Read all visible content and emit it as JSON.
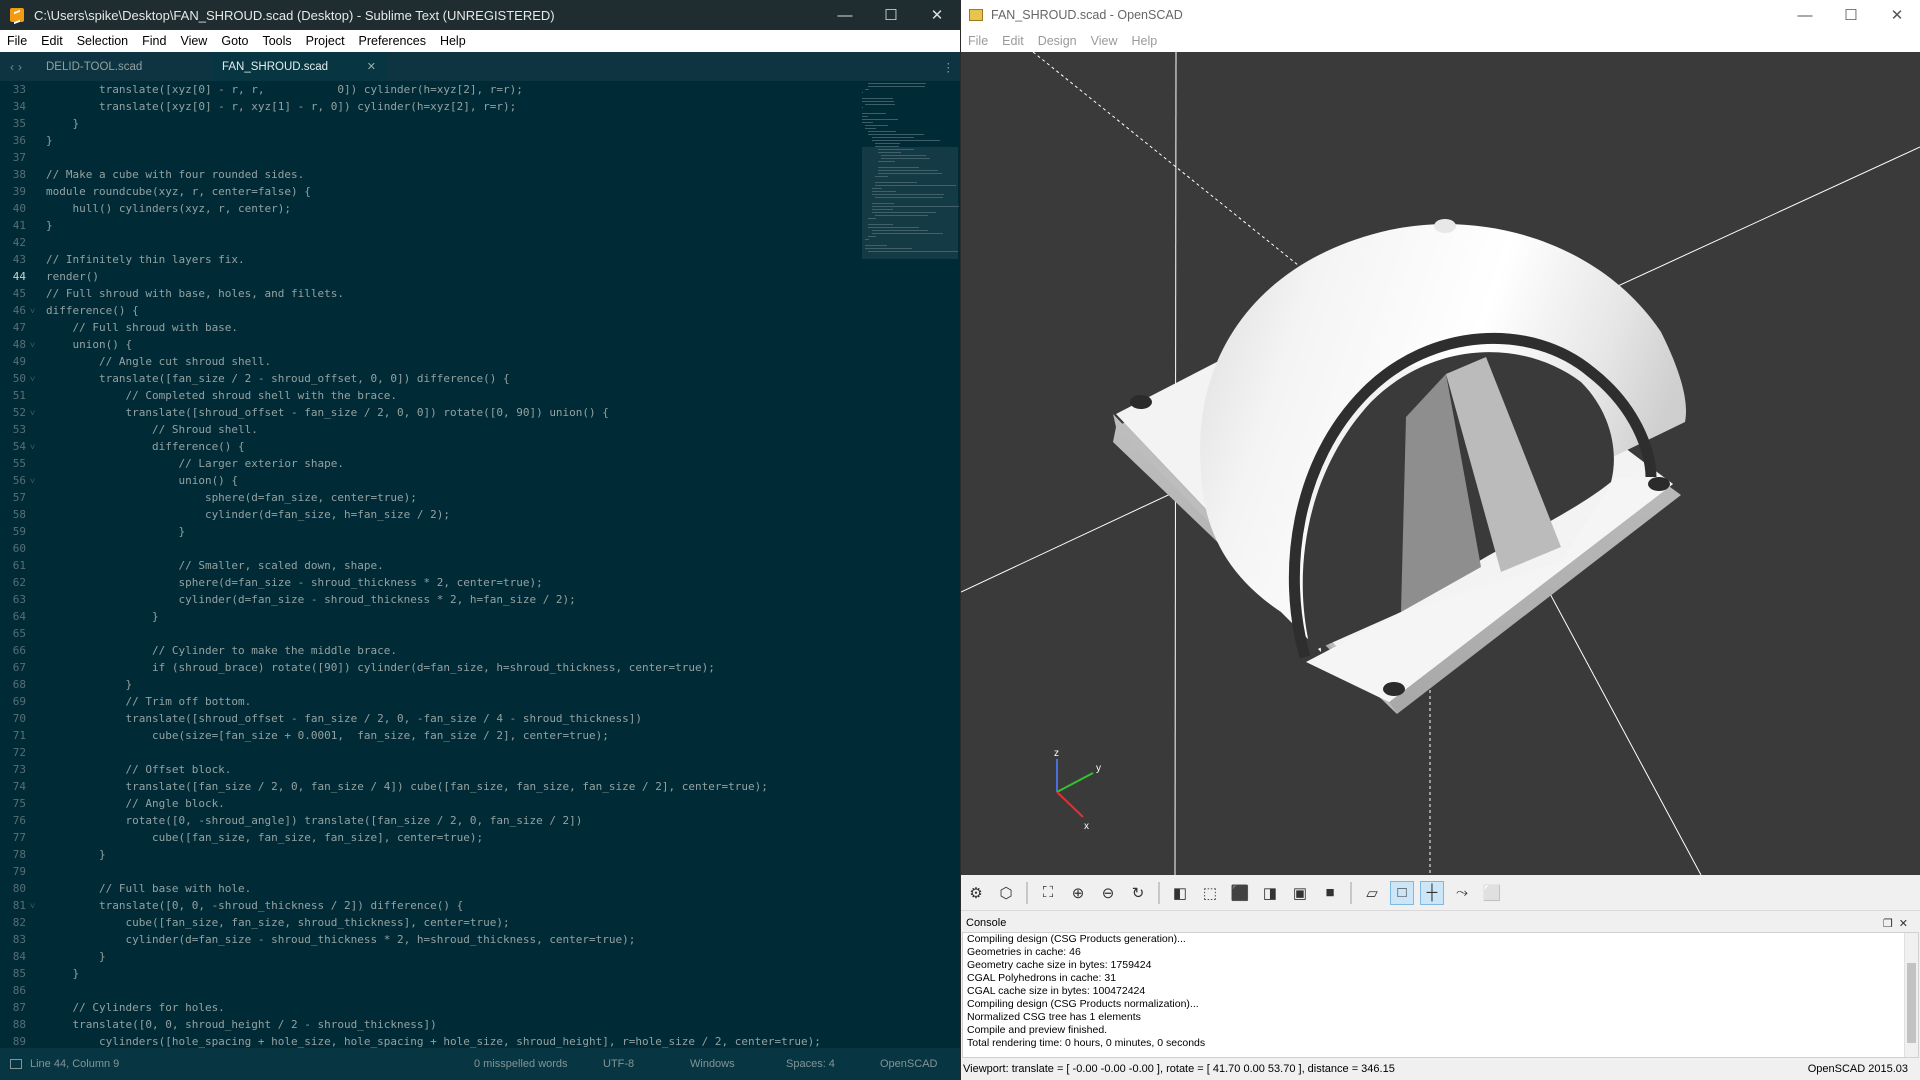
{
  "sublime": {
    "title": "C:\\Users\\spike\\Desktop\\FAN_SHROUD.scad (Desktop) - Sublime Text (UNREGISTERED)",
    "menu": [
      "File",
      "Edit",
      "Selection",
      "Find",
      "View",
      "Goto",
      "Tools",
      "Project",
      "Preferences",
      "Help"
    ],
    "tabs": [
      {
        "label": "DELID-TOOL.scad",
        "active": false
      },
      {
        "label": "FAN_SHROUD.scad",
        "active": true
      }
    ],
    "colors": {
      "background": "#002b36",
      "comment": "#586e75",
      "keyword": "#859900",
      "function": "#268bd2",
      "number": "#d33682",
      "text": "#93a1a1",
      "constant": "#cb4b16"
    },
    "code_lines": [
      {
        "n": "33",
        "fold": false,
        "t": "        translate([xyz[0] - r, r,           0]) cylinder(h=xyz[2], r=r);"
      },
      {
        "n": "34",
        "fold": false,
        "t": "        translate([xyz[0] - r, xyz[1] - r, 0]) cylinder(h=xyz[2], r=r);"
      },
      {
        "n": "35",
        "fold": false,
        "t": "    }"
      },
      {
        "n": "36",
        "fold": false,
        "t": "}"
      },
      {
        "n": "37",
        "fold": false,
        "t": ""
      },
      {
        "n": "38",
        "fold": false,
        "t": "// Make a cube with four rounded sides."
      },
      {
        "n": "39",
        "fold": false,
        "t": "module roundcube(xyz, r, center=false) {"
      },
      {
        "n": "40",
        "fold": false,
        "t": "    hull() cylinders(xyz, r, center);"
      },
      {
        "n": "41",
        "fold": false,
        "t": "}"
      },
      {
        "n": "42",
        "fold": false,
        "t": ""
      },
      {
        "n": "43",
        "fold": false,
        "t": "// Infinitely thin layers fix."
      },
      {
        "n": "44",
        "fold": false,
        "t": "render()"
      },
      {
        "n": "45",
        "fold": false,
        "t": "// Full shroud with base, holes, and fillets."
      },
      {
        "n": "46",
        "fold": true,
        "t": "difference() {"
      },
      {
        "n": "47",
        "fold": false,
        "t": "    // Full shroud with base."
      },
      {
        "n": "48",
        "fold": true,
        "t": "    union() {"
      },
      {
        "n": "49",
        "fold": false,
        "t": "        // Angle cut shroud shell."
      },
      {
        "n": "50",
        "fold": true,
        "t": "        translate([fan_size / 2 - shroud_offset, 0, 0]) difference() {"
      },
      {
        "n": "51",
        "fold": false,
        "t": "            // Completed shroud shell with the brace."
      },
      {
        "n": "52",
        "fold": true,
        "t": "            translate([shroud_offset - fan_size / 2, 0, 0]) rotate([0, 90]) union() {"
      },
      {
        "n": "53",
        "fold": false,
        "t": "                // Shroud shell."
      },
      {
        "n": "54",
        "fold": true,
        "t": "                difference() {"
      },
      {
        "n": "55",
        "fold": false,
        "t": "                    // Larger exterior shape."
      },
      {
        "n": "56",
        "fold": true,
        "t": "                    union() {"
      },
      {
        "n": "57",
        "fold": false,
        "t": "                        sphere(d=fan_size, center=true);"
      },
      {
        "n": "58",
        "fold": false,
        "t": "                        cylinder(d=fan_size, h=fan_size / 2);"
      },
      {
        "n": "59",
        "fold": false,
        "t": "                    }"
      },
      {
        "n": "60",
        "fold": false,
        "t": ""
      },
      {
        "n": "61",
        "fold": false,
        "t": "                    // Smaller, scaled down, shape."
      },
      {
        "n": "62",
        "fold": false,
        "t": "                    sphere(d=fan_size - shroud_thickness * 2, center=true);"
      },
      {
        "n": "63",
        "fold": false,
        "t": "                    cylinder(d=fan_size - shroud_thickness * 2, h=fan_size / 2);"
      },
      {
        "n": "64",
        "fold": false,
        "t": "                }"
      },
      {
        "n": "65",
        "fold": false,
        "t": ""
      },
      {
        "n": "66",
        "fold": false,
        "t": "                // Cylinder to make the middle brace."
      },
      {
        "n": "67",
        "fold": false,
        "t": "                if (shroud_brace) rotate([90]) cylinder(d=fan_size, h=shroud_thickness, center=true);"
      },
      {
        "n": "68",
        "fold": false,
        "t": "            }"
      },
      {
        "n": "69",
        "fold": false,
        "t": "            // Trim off bottom."
      },
      {
        "n": "70",
        "fold": false,
        "t": "            translate([shroud_offset - fan_size / 2, 0, -fan_size / 4 - shroud_thickness])"
      },
      {
        "n": "71",
        "fold": false,
        "t": "                cube(size=[fan_size + 0.0001,  fan_size, fan_size / 2], center=true);"
      },
      {
        "n": "72",
        "fold": false,
        "t": ""
      },
      {
        "n": "73",
        "fold": false,
        "t": "            // Offset block."
      },
      {
        "n": "74",
        "fold": false,
        "t": "            translate([fan_size / 2, 0, fan_size / 4]) cube([fan_size, fan_size, fan_size / 2], center=true);"
      },
      {
        "n": "75",
        "fold": false,
        "t": "            // Angle block."
      },
      {
        "n": "76",
        "fold": false,
        "t": "            rotate([0, -shroud_angle]) translate([fan_size / 2, 0, fan_size / 2])"
      },
      {
        "n": "77",
        "fold": false,
        "t": "                cube([fan_size, fan_size, fan_size], center=true);"
      },
      {
        "n": "78",
        "fold": false,
        "t": "        }"
      },
      {
        "n": "79",
        "fold": false,
        "t": ""
      },
      {
        "n": "80",
        "fold": false,
        "t": "        // Full base with hole."
      },
      {
        "n": "81",
        "fold": true,
        "t": "        translate([0, 0, -shroud_thickness / 2]) difference() {"
      },
      {
        "n": "82",
        "fold": false,
        "t": "            cube([fan_size, fan_size, shroud_thickness], center=true);"
      },
      {
        "n": "83",
        "fold": false,
        "t": "            cylinder(d=fan_size - shroud_thickness * 2, h=shroud_thickness, center=true);"
      },
      {
        "n": "84",
        "fold": false,
        "t": "        }"
      },
      {
        "n": "85",
        "fold": false,
        "t": "    }"
      },
      {
        "n": "86",
        "fold": false,
        "t": ""
      },
      {
        "n": "87",
        "fold": false,
        "t": "    // Cylinders for holes."
      },
      {
        "n": "88",
        "fold": false,
        "t": "    translate([0, 0, shroud_height / 2 - shroud_thickness])"
      },
      {
        "n": "89",
        "fold": false,
        "t": "        cylinders([hole_spacing + hole_size, hole_spacing + hole_size, shroud_height], r=hole_size / 2, center=true);"
      }
    ],
    "status": {
      "position": "Line 44, Column 9",
      "spelling": "0 misspelled words",
      "encoding": "UTF-8",
      "line_endings": "Windows",
      "indent": "Spaces: 4",
      "syntax": "OpenSCAD"
    }
  },
  "openscad": {
    "title": "FAN_SHROUD.scad - OpenSCAD",
    "menu": [
      "File",
      "Edit",
      "Design",
      "View",
      "Help"
    ],
    "axes": {
      "z": "z",
      "y": "y",
      "x": "x"
    },
    "toolbar_icons": [
      "preview-icon",
      "render-icon",
      "view-all-icon",
      "zoom-in-icon",
      "zoom-out-icon",
      "reset-view-icon",
      "view-right-icon",
      "view-top-icon",
      "view-bottom-icon",
      "view-left-icon",
      "view-front-icon",
      "view-back-icon",
      "perspective-icon",
      "orthogonal-icon",
      "show-axes-icon",
      "show-scale-icon",
      "show-edges-icon"
    ],
    "console_title": "Console",
    "console_lines": [
      "Compiling design (CSG Products generation)...",
      "Geometries in cache: 46",
      "Geometry cache size in bytes: 1759424",
      "CGAL Polyhedrons in cache: 31",
      "CGAL cache size in bytes: 100472424",
      "Compiling design (CSG Products normalization)...",
      "Normalized CSG tree has 1 elements",
      "Compile and preview finished.",
      "Total rendering time: 0 hours, 0 minutes, 0 seconds"
    ],
    "status_viewport": "Viewport: translate = [ -0.00 -0.00 -0.00 ], rotate = [ 41.70 0.00 53.70 ], distance = 346.15",
    "status_version": "OpenSCAD 2015.03",
    "colors": {
      "viewport_bg": "#3a3a3a",
      "model": "#f2f2f2"
    }
  }
}
